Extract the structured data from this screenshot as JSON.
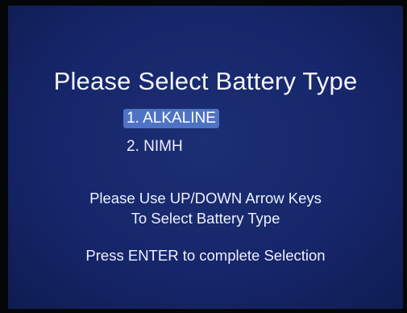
{
  "title": "Please Select Battery Type",
  "options": [
    {
      "label": "1. ALKALINE",
      "selected": true
    },
    {
      "label": "2. NIMH",
      "selected": false
    }
  ],
  "instructions": {
    "line1": "Please Use UP/DOWN Arrow Keys",
    "line2": "To Select Battery Type"
  },
  "enter_note": "Press ENTER to complete Selection",
  "colors": {
    "screen_background": "#16266a",
    "selection_highlight": "#4f73c4",
    "text": "#f2f4fb",
    "bezel": "#050607"
  }
}
